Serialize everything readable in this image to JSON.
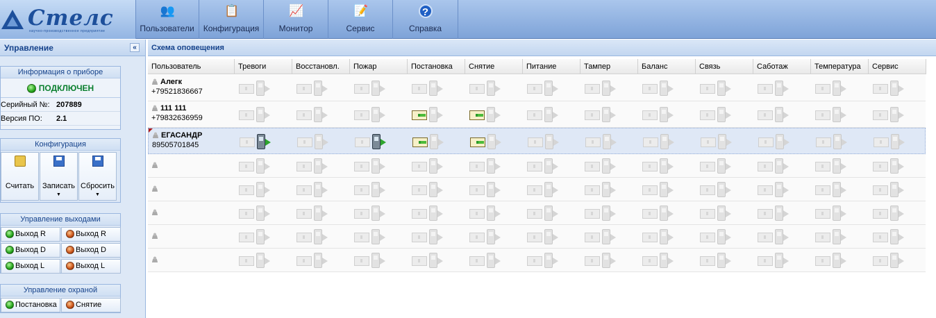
{
  "app": {
    "logo_name": "Стелс",
    "logo_sub": "научно-производственное предприятие"
  },
  "toolbar": [
    {
      "label": "Пользователи",
      "icon": "users-icon"
    },
    {
      "label": "Конфигурация",
      "icon": "configuration-icon"
    },
    {
      "label": "Монитор",
      "icon": "monitor-icon"
    },
    {
      "label": "Сервис",
      "icon": "service-icon"
    },
    {
      "label": "Справка",
      "icon": "help-icon",
      "glyph": "?"
    }
  ],
  "left": {
    "title": "Управление",
    "collapse": "«",
    "device_info": {
      "title": "Информация о приборе",
      "status": "ПОДКЛЮЧЕН",
      "serial_label": "Серийный №:",
      "serial_value": "207889",
      "fw_label": "Версия ПО:",
      "fw_value": "2.1"
    },
    "config": {
      "title": "Конфигурация",
      "read": "Считать",
      "write": "Записать",
      "reset": "Сбросить",
      "dropdown": "▼"
    },
    "outputs": {
      "title": "Управление выходами",
      "buttons": [
        {
          "label": "Выход R",
          "state": "green"
        },
        {
          "label": "Выход R",
          "state": "orange"
        },
        {
          "label": "Выход D",
          "state": "green"
        },
        {
          "label": "Выход D",
          "state": "orange"
        },
        {
          "label": "Выход L",
          "state": "green"
        },
        {
          "label": "Выход L",
          "state": "orange"
        }
      ]
    },
    "guard": {
      "title": "Управление охраной",
      "arm": "Постановка",
      "disarm": "Снятие"
    }
  },
  "main": {
    "title": "Схема оповещения",
    "columns": [
      "Пользователь",
      "Тревоги",
      "Восстановл.",
      "Пожар",
      "Постановка",
      "Снятие",
      "Питание",
      "Тампер",
      "Баланс",
      "Связь",
      "Саботаж",
      "Температура",
      "Сервис"
    ],
    "rows": [
      {
        "name": "Алегк",
        "phone": "+79521836667",
        "sms": [],
        "call": []
      },
      {
        "name": "111 111",
        "phone": "+79832636959",
        "sms": [
          3,
          4
        ],
        "call": []
      },
      {
        "name": "ЕГАСАНДР",
        "phone": "89505701845",
        "sms": [
          3,
          4
        ],
        "call": [
          0,
          2
        ],
        "selected": true
      },
      {
        "name": "",
        "phone": "",
        "sms": [],
        "call": []
      },
      {
        "name": "",
        "phone": "",
        "sms": [],
        "call": []
      },
      {
        "name": "",
        "phone": "",
        "sms": [],
        "call": []
      },
      {
        "name": "",
        "phone": "",
        "sms": [],
        "call": []
      },
      {
        "name": "",
        "phone": "",
        "sms": [],
        "call": []
      }
    ]
  }
}
